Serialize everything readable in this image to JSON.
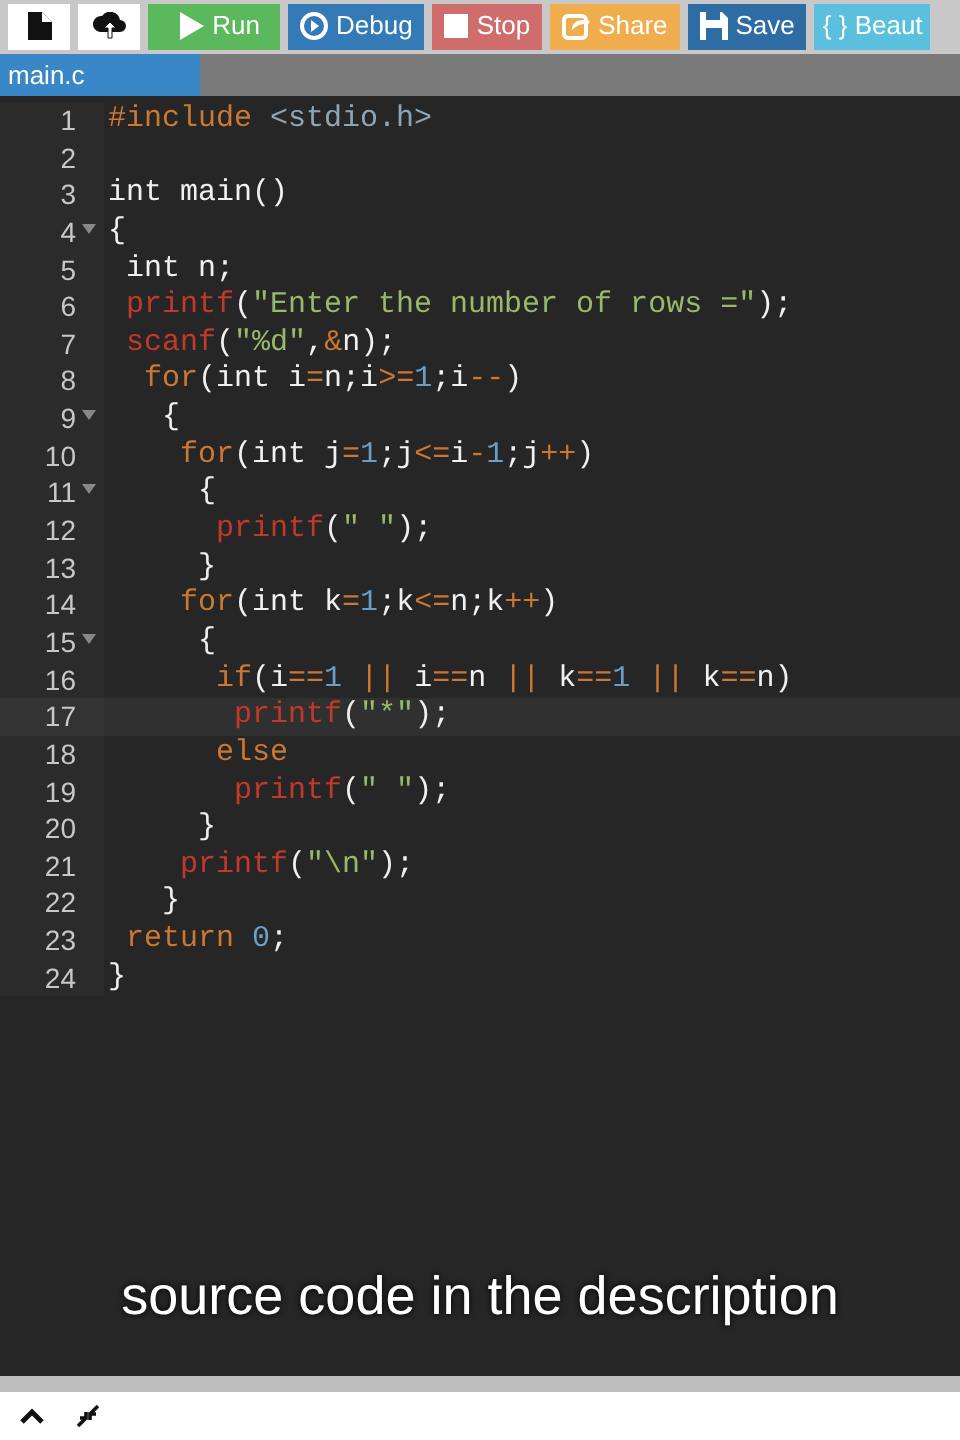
{
  "toolbar": [
    {
      "kind": "new-file"
    },
    {
      "kind": "upload"
    },
    {
      "kind": "run",
      "label": "Run"
    },
    {
      "kind": "debug",
      "label": "Debug"
    },
    {
      "kind": "stop",
      "label": "Stop"
    },
    {
      "kind": "share",
      "label": "Share"
    },
    {
      "kind": "save",
      "label": "Save"
    },
    {
      "kind": "beautify",
      "label": "{ } Beaut"
    }
  ],
  "tabs": [
    {
      "label": "main.c",
      "selected": true
    }
  ],
  "editor": {
    "lines": [
      {
        "number": "1",
        "fold": false,
        "active": false,
        "tokens": [
          {
            "t": "#include ",
            "kind": "keyword"
          },
          {
            "t": "<stdio.h>",
            "kind": "header"
          }
        ]
      },
      {
        "number": "2",
        "fold": false,
        "active": false
      },
      {
        "number": "3",
        "fold": false,
        "active": false,
        "tokens": [
          {
            "t": "int main()",
            "kind": "plain"
          }
        ]
      },
      {
        "number": "4",
        "fold": true,
        "active": false,
        "tokens": [
          {
            "t": "{",
            "kind": "plain"
          }
        ]
      },
      {
        "number": "5",
        "fold": false,
        "active": false,
        "tokens": [
          {
            "t": " int n;",
            "kind": "plain"
          }
        ]
      },
      {
        "number": "6",
        "fold": false,
        "active": false,
        "tokens": [
          {
            "t": " printf",
            "kind": "function"
          },
          {
            "t": "(",
            "kind": "plain"
          },
          {
            "t": "\"Enter the number of rows =\"",
            "kind": "string"
          },
          {
            "t": ");",
            "kind": "plain"
          }
        ]
      },
      {
        "number": "7",
        "fold": false,
        "active": false,
        "tokens": [
          {
            "t": " scanf",
            "kind": "function"
          },
          {
            "t": "(",
            "kind": "plain"
          },
          {
            "t": "\"%d\"",
            "kind": "string"
          },
          {
            "t": ",",
            "kind": "plain"
          },
          {
            "t": "&",
            "kind": "keyword"
          },
          {
            "t": "n);",
            "kind": "plain"
          }
        ]
      },
      {
        "number": "8",
        "fold": false,
        "active": false,
        "tokens": [
          {
            "t": "  for",
            "kind": "keyword"
          },
          {
            "t": "(int i",
            "kind": "plain"
          },
          {
            "t": "=",
            "kind": "keyword"
          },
          {
            "t": "n;i",
            "kind": "plain"
          },
          {
            "t": ">=",
            "kind": "keyword"
          },
          {
            "t": "1",
            "kind": "number"
          },
          {
            "t": ";i",
            "kind": "plain"
          },
          {
            "t": "--",
            "kind": "keyword"
          },
          {
            "t": ")",
            "kind": "plain"
          }
        ]
      },
      {
        "number": "9",
        "fold": true,
        "active": false,
        "tokens": [
          {
            "t": "   {",
            "kind": "plain"
          }
        ]
      },
      {
        "number": "10",
        "fold": false,
        "active": false,
        "tokens": [
          {
            "t": "    for",
            "kind": "keyword"
          },
          {
            "t": "(int j",
            "kind": "plain"
          },
          {
            "t": "=",
            "kind": "keyword"
          },
          {
            "t": "1",
            "kind": "number"
          },
          {
            "t": ";j",
            "kind": "plain"
          },
          {
            "t": "<=",
            "kind": "keyword"
          },
          {
            "t": "i",
            "kind": "plain"
          },
          {
            "t": "-",
            "kind": "keyword"
          },
          {
            "t": "1",
            "kind": "number"
          },
          {
            "t": ";j",
            "kind": "plain"
          },
          {
            "t": "++",
            "kind": "keyword"
          },
          {
            "t": ")",
            "kind": "plain"
          }
        ]
      },
      {
        "number": "11",
        "fold": true,
        "active": false,
        "tokens": [
          {
            "t": "     {",
            "kind": "plain"
          }
        ]
      },
      {
        "number": "12",
        "fold": false,
        "active": false,
        "tokens": [
          {
            "t": "      printf",
            "kind": "function"
          },
          {
            "t": "(",
            "kind": "plain"
          },
          {
            "t": "\" \"",
            "kind": "string"
          },
          {
            "t": ");",
            "kind": "plain"
          }
        ]
      },
      {
        "number": "13",
        "fold": false,
        "active": false,
        "tokens": [
          {
            "t": "     }",
            "kind": "plain"
          }
        ]
      },
      {
        "number": "14",
        "fold": false,
        "active": false,
        "tokens": [
          {
            "t": "    for",
            "kind": "keyword"
          },
          {
            "t": "(int k",
            "kind": "plain"
          },
          {
            "t": "=",
            "kind": "keyword"
          },
          {
            "t": "1",
            "kind": "number"
          },
          {
            "t": ";k",
            "kind": "plain"
          },
          {
            "t": "<=",
            "kind": "keyword"
          },
          {
            "t": "n;k",
            "kind": "plain"
          },
          {
            "t": "++",
            "kind": "keyword"
          },
          {
            "t": ")",
            "kind": "plain"
          }
        ]
      },
      {
        "number": "15",
        "fold": true,
        "active": false,
        "tokens": [
          {
            "t": "     {",
            "kind": "plain"
          }
        ]
      },
      {
        "number": "16",
        "fold": false,
        "active": false,
        "tokens": [
          {
            "t": "      if",
            "kind": "keyword"
          },
          {
            "t": "(i",
            "kind": "plain"
          },
          {
            "t": "==",
            "kind": "keyword"
          },
          {
            "t": "1",
            "kind": "number"
          },
          {
            "t": " ||",
            "kind": "keyword"
          },
          {
            "t": " i",
            "kind": "plain"
          },
          {
            "t": "==",
            "kind": "keyword"
          },
          {
            "t": "n ",
            "kind": "plain"
          },
          {
            "t": "||",
            "kind": "keyword"
          },
          {
            "t": " k",
            "kind": "plain"
          },
          {
            "t": "==",
            "kind": "keyword"
          },
          {
            "t": "1",
            "kind": "number"
          },
          {
            "t": " ||",
            "kind": "keyword"
          },
          {
            "t": " k",
            "kind": "plain"
          },
          {
            "t": "==",
            "kind": "keyword"
          },
          {
            "t": "n)",
            "kind": "plain"
          }
        ]
      },
      {
        "number": "17",
        "fold": false,
        "active": true,
        "tokens": [
          {
            "t": "       printf",
            "kind": "function"
          },
          {
            "t": "(",
            "kind": "plain"
          },
          {
            "t": "\"*\"",
            "kind": "string"
          },
          {
            "t": ");",
            "kind": "plain"
          }
        ]
      },
      {
        "number": "18",
        "fold": false,
        "active": false,
        "tokens": [
          {
            "t": "      else",
            "kind": "keyword"
          }
        ]
      },
      {
        "number": "19",
        "fold": false,
        "active": false,
        "tokens": [
          {
            "t": "       printf",
            "kind": "function"
          },
          {
            "t": "(",
            "kind": "plain"
          },
          {
            "t": "\" \"",
            "kind": "string"
          },
          {
            "t": ");",
            "kind": "plain"
          }
        ]
      },
      {
        "number": "20",
        "fold": false,
        "active": false,
        "tokens": [
          {
            "t": "     }",
            "kind": "plain"
          }
        ]
      },
      {
        "number": "21",
        "fold": false,
        "active": false,
        "tokens": [
          {
            "t": "    printf",
            "kind": "function"
          },
          {
            "t": "(",
            "kind": "plain"
          },
          {
            "t": "\"\\n\"",
            "kind": "string"
          },
          {
            "t": ");",
            "kind": "plain"
          }
        ]
      },
      {
        "number": "22",
        "fold": false,
        "active": false,
        "tokens": [
          {
            "t": "   }",
            "kind": "plain"
          }
        ]
      },
      {
        "number": "23",
        "fold": false,
        "active": false,
        "tokens": [
          {
            "t": " return ",
            "kind": "keyword"
          },
          {
            "t": "0",
            "kind": "number"
          },
          {
            "t": ";",
            "kind": "plain"
          }
        ]
      },
      {
        "number": "24",
        "fold": false,
        "active": false,
        "tokens": [
          {
            "t": "}",
            "kind": "plain"
          }
        ]
      }
    ]
  },
  "caption": "source code in the description",
  "bottom_bar": [
    {
      "kind": "expand"
    },
    {
      "kind": "collapse"
    }
  ]
}
